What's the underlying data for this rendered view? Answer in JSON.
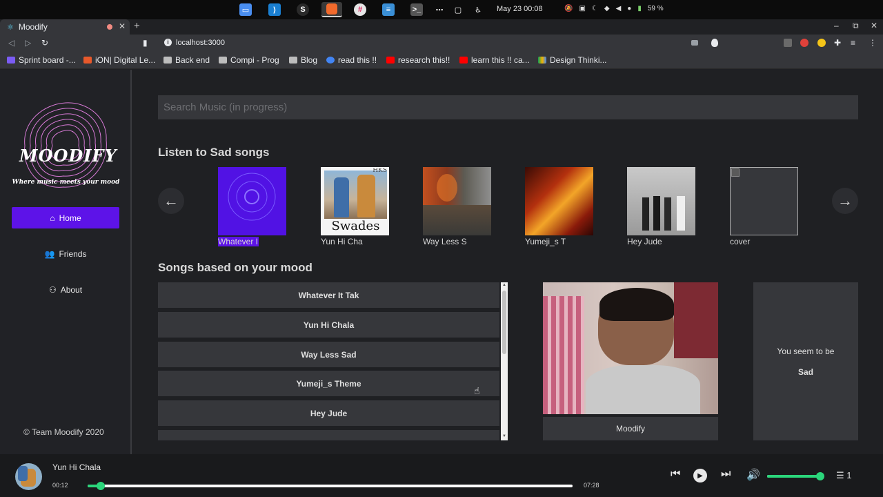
{
  "os": {
    "clock": "May 23  00:08",
    "battery": "59 %",
    "taskbar_icons": [
      "files-icon",
      "vscode-icon",
      "skype-icon",
      "brave-icon",
      "slack-icon",
      "settings-icon",
      "terminal-icon",
      "apps-icon",
      "clipboard-icon",
      "accessibility-icon"
    ]
  },
  "browser": {
    "tab_title": "Moodify",
    "url": "localhost:3000",
    "bookmarks": [
      "Sprint board -...",
      "iON| Digital Le...",
      "Back end",
      "Compi - Prog",
      "Blog",
      "read this !!",
      "research this!!",
      "learn this !! ca...",
      "Design Thinki..."
    ]
  },
  "sidebar": {
    "logo_title": "MOODIFY",
    "logo_tagline": "Where music meets your mood",
    "nav": [
      {
        "label": "Home",
        "icon": "home-icon",
        "active": true
      },
      {
        "label": "Friends",
        "icon": "users-icon",
        "active": false
      },
      {
        "label": "About",
        "icon": "people-icon",
        "active": false
      }
    ],
    "footer": "© Team Moodify 2020"
  },
  "main": {
    "search_placeholder": "Search Music (in progress)",
    "carousel_title": "Listen to Sad songs",
    "carousel": [
      {
        "label": "Whatever I",
        "highlighted": true
      },
      {
        "label": "Yun Hi Cha",
        "cover_text": "Swades",
        "cover_corner": "HKS"
      },
      {
        "label": "Way Less S"
      },
      {
        "label": "Yumeji_s T"
      },
      {
        "label": "Hey Jude"
      },
      {
        "label": "cover"
      }
    ],
    "mood_list_title": "Songs based on your mood",
    "mood_songs": [
      "Whatever It Tak",
      "Yun Hi Chala",
      "Way Less Sad",
      "Yumeji_s Theme",
      "Hey Jude"
    ],
    "webcam_label": "Moodify",
    "mood_prefix": "You seem to be",
    "mood_value": "Sad"
  },
  "player": {
    "title": "Yun Hi Chala",
    "elapsed": "00:12",
    "duration": "07:28",
    "progress_fraction": 0.027,
    "volume_fraction": 1.0,
    "queue_count": "1"
  },
  "colors": {
    "accent": "#5d13e8",
    "progress": "#2bd67b",
    "surface": "#36373b",
    "background": "#1f2023"
  }
}
